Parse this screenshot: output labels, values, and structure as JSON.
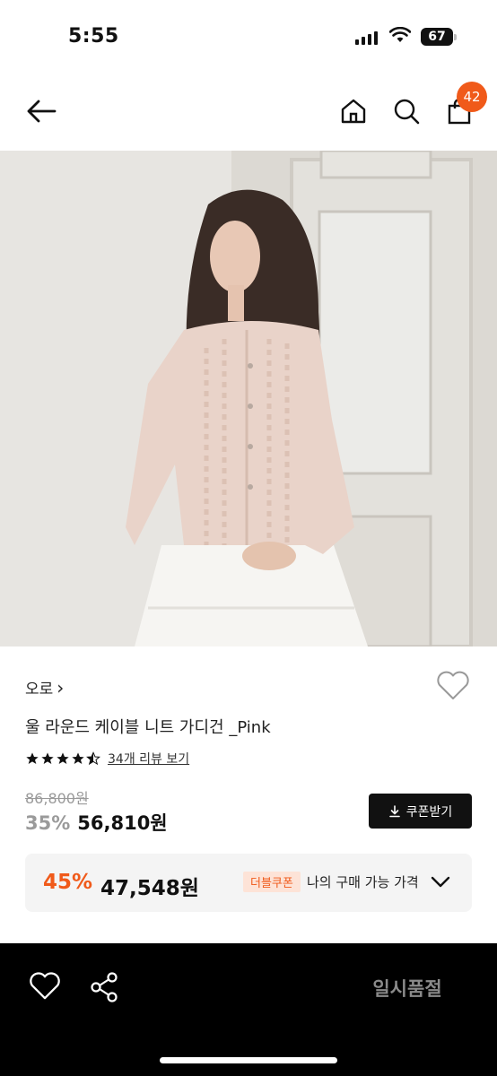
{
  "status_bar": {
    "time": "5:55",
    "battery": "67"
  },
  "nav": {
    "cart_count": "42"
  },
  "product": {
    "brand": "오로",
    "brand_chevron": "›",
    "name": "울 라운드 케이블 니트 가디건 _Pink",
    "rating": 4.5,
    "review_link": "34개 리뷰 보기",
    "original_price": "86,800원",
    "discount_percent": "35%",
    "sale_price": "56,810원",
    "coupon_button": "쿠폰받기"
  },
  "best_price": {
    "discount_percent": "45%",
    "price": "47,548원",
    "badge": "더블쿠폰",
    "label": "나의 구매 가능 가격"
  },
  "bottom_bar": {
    "sold_out_label": "일시품절"
  },
  "colors": {
    "accent": "#f05a1a",
    "badge_bg": "#fde3d7",
    "dark": "#111111"
  },
  "icons": [
    "back-arrow-icon",
    "home-icon",
    "search-icon",
    "shopping-bag-icon",
    "heart-icon",
    "star-icon",
    "download-icon",
    "chevron-down-icon",
    "share-icon"
  ]
}
